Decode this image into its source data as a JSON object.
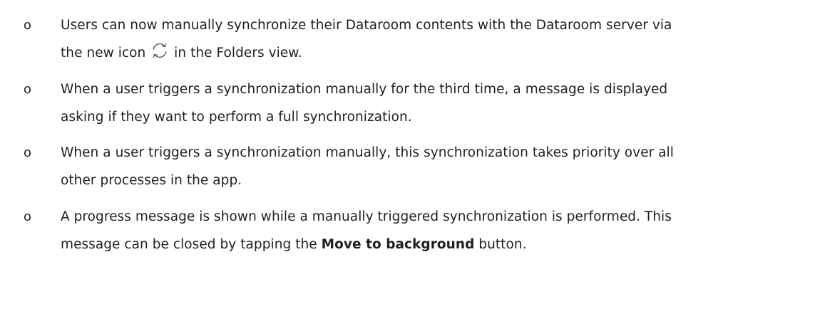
{
  "bullet_marker": "o",
  "items": [
    {
      "line1": "Users can now manually synchronize their Dataroom contents with the Dataroom server via",
      "line2_before_icon": "the new icon ",
      "icon": "sync-icon",
      "line2_after_icon": " in the Folders view."
    },
    {
      "line1": "When a user triggers a synchronization manually for the third time, a message is displayed",
      "line2": "asking if they want to perform a full synchronization."
    },
    {
      "line1": "When a user triggers a synchronization manually, this synchronization takes priority over all",
      "line2": "other processes in the app."
    },
    {
      "line1": "A progress message is shown while a manually triggered synchronization is performed. This",
      "line2_before_bold": "message can be closed by tapping the ",
      "line2_bold": "Move to background",
      "line2_after_bold": " button."
    }
  ]
}
